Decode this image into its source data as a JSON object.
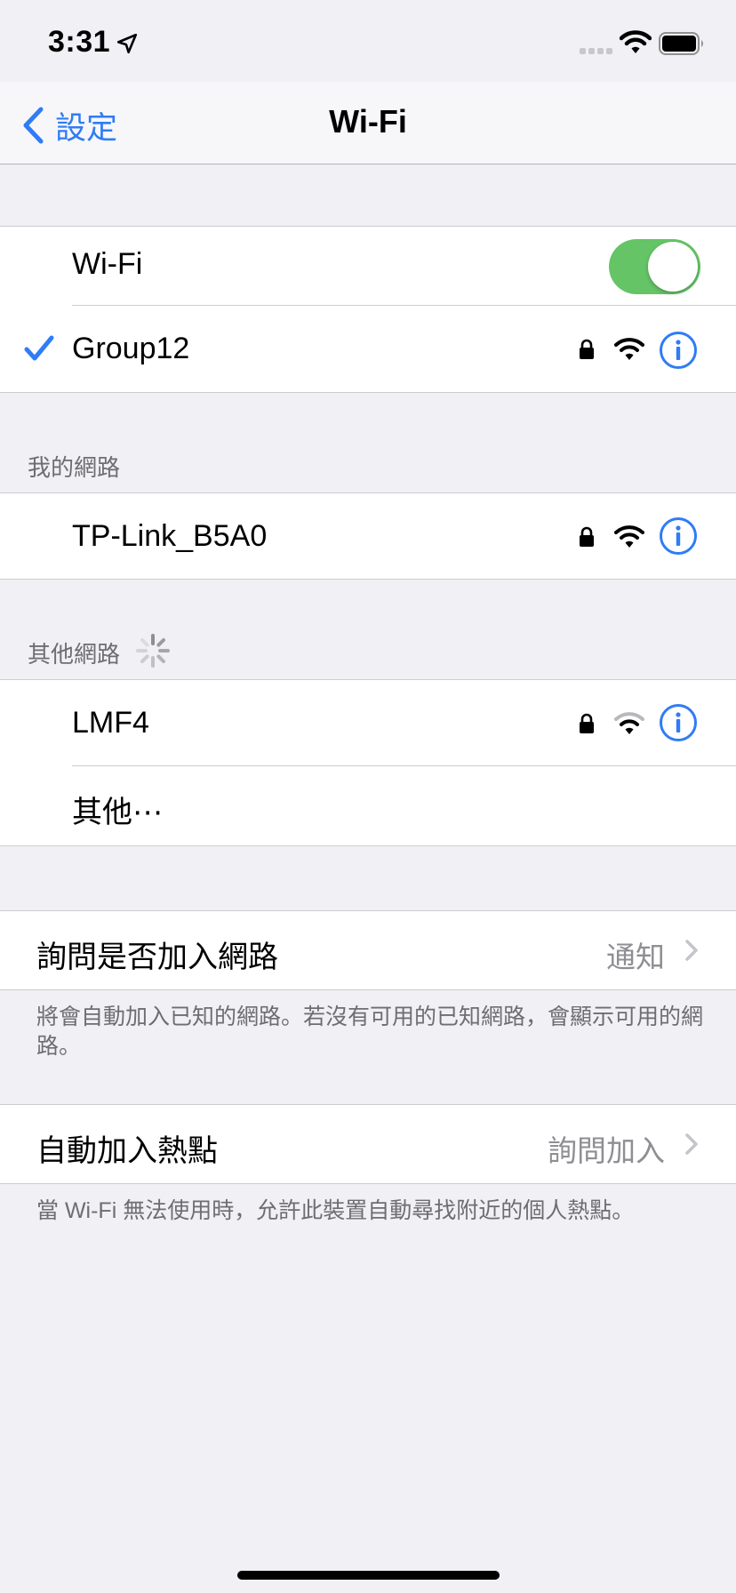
{
  "status_bar": {
    "time": "3:31",
    "location_icon": "location-arrow-icon",
    "signal_icon": "cellular-signal-icon",
    "wifi_icon": "wifi-icon",
    "battery_icon": "battery-icon"
  },
  "nav": {
    "back_label": "設定",
    "title": "Wi-Fi"
  },
  "wifi_group": {
    "toggle_label": "Wi-Fi",
    "toggle_on": true,
    "connected_network": "Group12"
  },
  "my_networks": {
    "header": "我的網路",
    "items": [
      {
        "name": "TP-Link_B5A0"
      }
    ]
  },
  "other_networks": {
    "header": "其他網路",
    "items": [
      {
        "name": "LMF4"
      }
    ],
    "other_label": "其他⋯"
  },
  "ask_to_join": {
    "label": "詢問是否加入網路",
    "value": "通知",
    "footer": "將會自動加入已知的網路。若沒有可用的已知網路，會顯示可用的網路。"
  },
  "auto_hotspot": {
    "label": "自動加入熱點",
    "value": "詢問加入",
    "footer": "當 Wi-Fi 無法使用時，允許此裝置自動尋找附近的個人熱點。"
  },
  "colors": {
    "accent": "#2f7cf6",
    "toggle_on": "#65c466",
    "background": "#f0f0f5"
  }
}
